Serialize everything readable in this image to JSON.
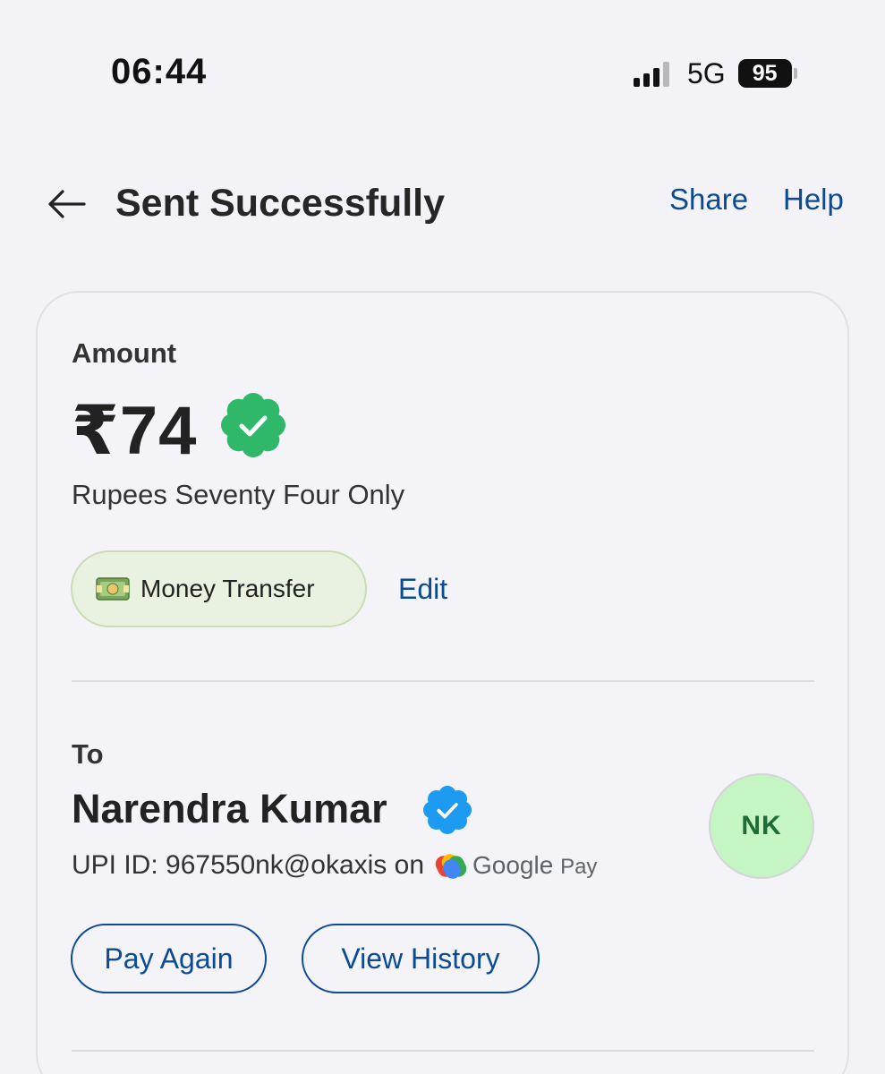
{
  "status_bar": {
    "time": "06:44",
    "network": "5G",
    "battery": "95"
  },
  "header": {
    "title": "Sent Successfully",
    "share_label": "Share",
    "help_label": "Help"
  },
  "amount": {
    "label": "Amount",
    "value": "₹74",
    "in_words": "Rupees Seventy Four Only",
    "category_label": "Money Transfer",
    "edit_label": "Edit"
  },
  "recipient": {
    "label": "To",
    "name": "Narendra Kumar",
    "upi_text": "UPI ID: 967550nk@okaxis on",
    "provider_main": "Google",
    "provider_pay": "Pay",
    "initials": "NK"
  },
  "actions": {
    "pay_again_label": "Pay Again",
    "view_history_label": "View History"
  },
  "colors": {
    "link": "#0b4a94",
    "verified_green": "#2fb86a",
    "verified_blue": "#1d9bf0",
    "avatar_bg": "#c5f5c3"
  },
  "icons": [
    "back-arrow-icon",
    "verified-badge-icon",
    "money-icon",
    "google-pay-icon",
    "signal-icon",
    "battery-icon"
  ]
}
